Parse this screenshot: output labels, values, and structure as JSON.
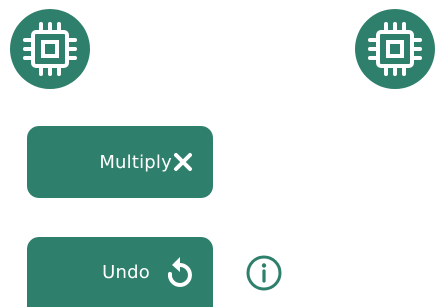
{
  "icons": {
    "chip_left": "chip-icon",
    "chip_right": "chip-icon",
    "multiply": "close-x-icon",
    "undo": "undo-icon",
    "info": "info-icon"
  },
  "buttons": {
    "multiply_label": "Multiply",
    "undo_label": "Undo"
  },
  "colors": {
    "accent": "#2e7f6b",
    "on_accent": "#ffffff"
  }
}
